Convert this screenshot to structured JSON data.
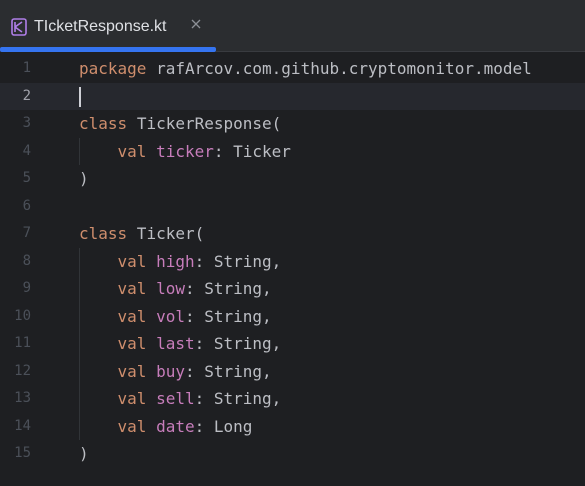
{
  "tab": {
    "filename": "TIcketResponse.kt",
    "icon": "kotlin-file-icon",
    "close_icon": "close-icon",
    "accent_color": "#3574f0"
  },
  "editor": {
    "current_line": 2,
    "lines": [
      {
        "number": "1",
        "tokens": [
          {
            "t": "package",
            "c": "kw"
          },
          {
            "t": " rafArcov.com.github.cryptomonitor.model",
            "c": "id"
          }
        ]
      },
      {
        "number": "2",
        "tokens": []
      },
      {
        "number": "3",
        "tokens": [
          {
            "t": "class",
            "c": "kw"
          },
          {
            "t": " ",
            "c": "id"
          },
          {
            "t": "TickerResponse",
            "c": "cls"
          },
          {
            "t": "(",
            "c": "id"
          }
        ]
      },
      {
        "number": "4",
        "tokens": [
          {
            "t": "    ",
            "c": "id"
          },
          {
            "t": "val",
            "c": "kw"
          },
          {
            "t": " ",
            "c": "id"
          },
          {
            "t": "ticker",
            "c": "prop"
          },
          {
            "t": ": Ticker",
            "c": "id"
          }
        ]
      },
      {
        "number": "5",
        "tokens": [
          {
            "t": ")",
            "c": "id"
          }
        ]
      },
      {
        "number": "6",
        "tokens": []
      },
      {
        "number": "7",
        "tokens": [
          {
            "t": "class",
            "c": "kw"
          },
          {
            "t": " Ticker(",
            "c": "id"
          }
        ]
      },
      {
        "number": "8",
        "tokens": [
          {
            "t": "    ",
            "c": "id"
          },
          {
            "t": "val",
            "c": "kw"
          },
          {
            "t": " ",
            "c": "id"
          },
          {
            "t": "high",
            "c": "prop"
          },
          {
            "t": ": String,",
            "c": "id"
          }
        ]
      },
      {
        "number": "9",
        "tokens": [
          {
            "t": "    ",
            "c": "id"
          },
          {
            "t": "val",
            "c": "kw"
          },
          {
            "t": " ",
            "c": "id"
          },
          {
            "t": "low",
            "c": "prop"
          },
          {
            "t": ": String,",
            "c": "id"
          }
        ]
      },
      {
        "number": "10",
        "tokens": [
          {
            "t": "    ",
            "c": "id"
          },
          {
            "t": "val",
            "c": "kw"
          },
          {
            "t": " ",
            "c": "id"
          },
          {
            "t": "vol",
            "c": "prop"
          },
          {
            "t": ": String,",
            "c": "id"
          }
        ]
      },
      {
        "number": "11",
        "tokens": [
          {
            "t": "    ",
            "c": "id"
          },
          {
            "t": "val",
            "c": "kw"
          },
          {
            "t": " ",
            "c": "id"
          },
          {
            "t": "last",
            "c": "prop"
          },
          {
            "t": ": String,",
            "c": "id"
          }
        ]
      },
      {
        "number": "12",
        "tokens": [
          {
            "t": "    ",
            "c": "id"
          },
          {
            "t": "val",
            "c": "kw"
          },
          {
            "t": " ",
            "c": "id"
          },
          {
            "t": "buy",
            "c": "prop"
          },
          {
            "t": ": String,",
            "c": "id"
          }
        ]
      },
      {
        "number": "13",
        "tokens": [
          {
            "t": "    ",
            "c": "id"
          },
          {
            "t": "val",
            "c": "kw"
          },
          {
            "t": " ",
            "c": "id"
          },
          {
            "t": "sell",
            "c": "prop"
          },
          {
            "t": ": String,",
            "c": "id"
          }
        ]
      },
      {
        "number": "14",
        "tokens": [
          {
            "t": "    ",
            "c": "id"
          },
          {
            "t": "val",
            "c": "kw"
          },
          {
            "t": " ",
            "c": "id"
          },
          {
            "t": "date",
            "c": "prop"
          },
          {
            "t": ": Long",
            "c": "id"
          }
        ]
      },
      {
        "number": "15",
        "tokens": [
          {
            "t": ")",
            "c": "id"
          }
        ]
      }
    ]
  }
}
